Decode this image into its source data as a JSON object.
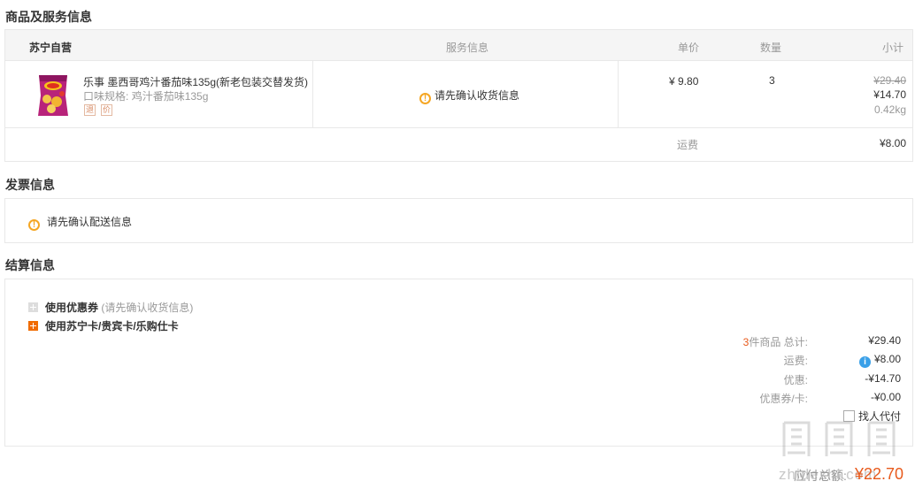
{
  "goods_section": {
    "title": "商品及服务信息",
    "store": "苏宁自营",
    "columns": {
      "service": "服务信息",
      "price": "单价",
      "qty": "数量",
      "subtotal": "小计"
    },
    "product": {
      "name": "乐事 墨西哥鸡汁番茄味135g(新老包装交替发货)",
      "spec_label": "口味规格:",
      "spec_value": "鸡汁番茄味135g",
      "tags": [
        "退",
        "价"
      ],
      "thumb_icon": "chips-bag-icon",
      "service_msg": "请先确认收货信息",
      "price": "¥ 9.80",
      "qty": "3",
      "subtotal_original": "¥29.40",
      "subtotal_now": "¥14.70",
      "weight": "0.42kg"
    },
    "shipping_label": "运费",
    "shipping_value": "¥8.00"
  },
  "invoice_section": {
    "title": "发票信息",
    "msg": "请先确认配送信息"
  },
  "settle_section": {
    "title": "结算信息",
    "coupon_label": "使用优惠券",
    "coupon_hint": "(请先确认收货信息)",
    "card_label": "使用苏宁卡/贵宾卡/乐购仕卡",
    "summary": {
      "count": "3",
      "count_suffix": "件商品 总计:",
      "total_value": "¥29.40",
      "freight_label": "运费:",
      "freight_value": "¥8.00",
      "discount_label": "优惠:",
      "discount_value": "-¥14.70",
      "coupon_card_label": "优惠券/卡:",
      "coupon_card_value": "-¥0.00",
      "proxy_label": "找人代付"
    },
    "payable_label": "应付总额:",
    "payable_value": "¥22.70"
  },
  "watermark_text": "zhidezhi.com",
  "colors": {
    "accent": "#e85a1c",
    "warn": "#f5a623",
    "info": "#3aa0e8",
    "orange": "#f06c00"
  }
}
